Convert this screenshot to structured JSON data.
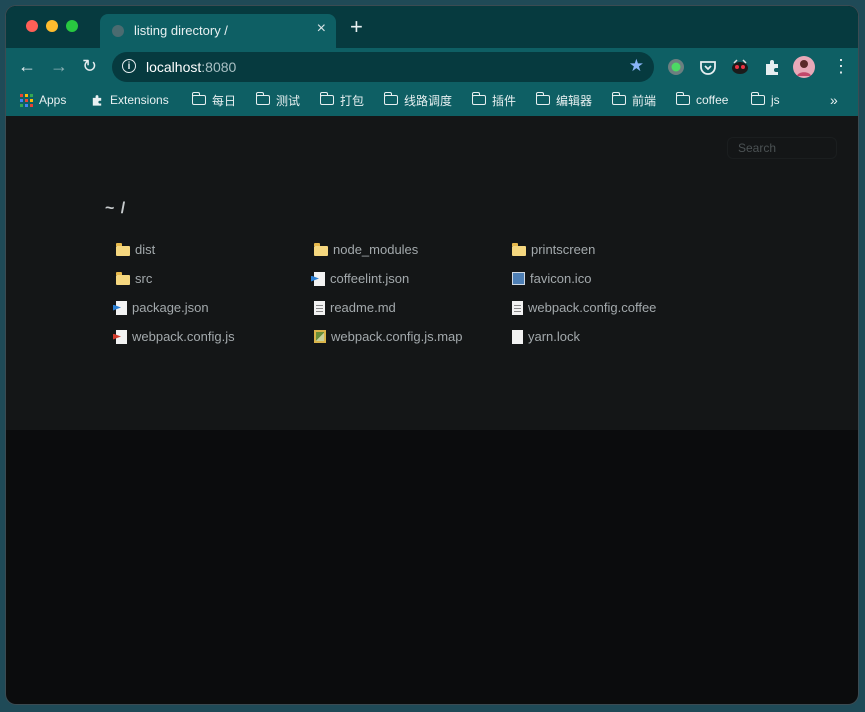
{
  "browser": {
    "tab_title": "listing directory /",
    "tab_close": "×",
    "new_tab": "+",
    "url_host": "localhost",
    "url_port": ":8080",
    "back": "←",
    "forward": "→",
    "reload": "↻",
    "star": "★",
    "menu": "⋮"
  },
  "bookmarks": {
    "apps": "Apps",
    "extensions": "Extensions",
    "folders": [
      "每日",
      "测试",
      "打包",
      "线路调度",
      "插件",
      "编辑器",
      "前端",
      "coffee",
      "js"
    ],
    "more": "»"
  },
  "page": {
    "search_placeholder": "Search",
    "path": "~ /"
  },
  "files": [
    {
      "name": "dist",
      "type": "folder"
    },
    {
      "name": "node_modules",
      "type": "folder"
    },
    {
      "name": "printscreen",
      "type": "folder"
    },
    {
      "name": "src",
      "type": "folder"
    },
    {
      "name": "coffeelint.json",
      "type": "json"
    },
    {
      "name": "favicon.ico",
      "type": "image"
    },
    {
      "name": "package.json",
      "type": "json"
    },
    {
      "name": "readme.md",
      "type": "doc"
    },
    {
      "name": "webpack.config.coffee",
      "type": "doc"
    },
    {
      "name": "webpack.config.js",
      "type": "js"
    },
    {
      "name": "webpack.config.js.map",
      "type": "map"
    },
    {
      "name": "yarn.lock",
      "type": "blank"
    }
  ],
  "colors": {
    "accent": "#0e5f64",
    "tabstrip": "#063a3f",
    "page_bg": "#141617"
  }
}
